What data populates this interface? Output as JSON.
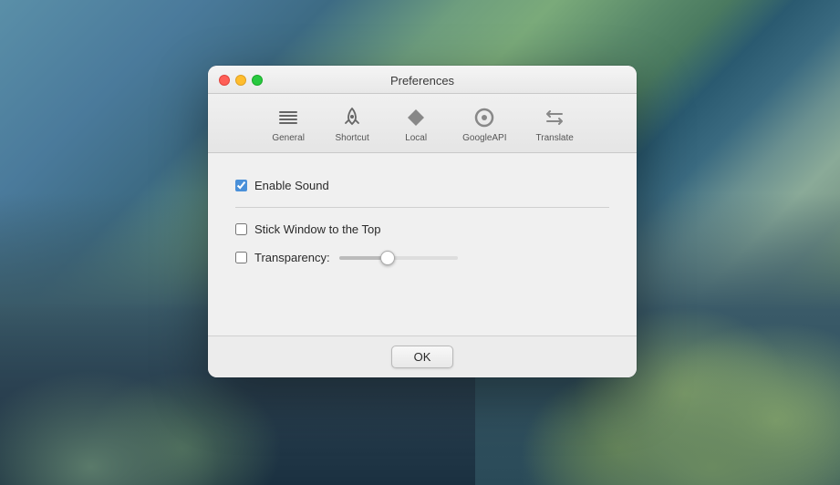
{
  "background": {
    "description": "macOS Catalina landscape wallpaper"
  },
  "dialog": {
    "title": "Preferences",
    "traffic_lights": {
      "close_label": "close",
      "minimize_label": "minimize",
      "maximize_label": "maximize"
    },
    "toolbar": {
      "items": [
        {
          "id": "general",
          "label": "General",
          "icon": "list-icon"
        },
        {
          "id": "shortcut",
          "label": "Shortcut",
          "icon": "rocket-icon"
        },
        {
          "id": "local",
          "label": "Local",
          "icon": "diamond-icon"
        },
        {
          "id": "googleapi",
          "label": "GoogleAPI",
          "icon": "circle-icon"
        },
        {
          "id": "translate",
          "label": "Translate",
          "icon": "arrows-icon"
        }
      ]
    },
    "settings": {
      "enable_sound": {
        "label": "Enable Sound",
        "checked": true
      },
      "stick_window": {
        "label": "Stick Window to the Top",
        "checked": false
      },
      "transparency": {
        "label": "Transparency:",
        "checked": false,
        "value": 40,
        "min": 0,
        "max": 100
      }
    },
    "footer": {
      "ok_label": "OK"
    }
  }
}
